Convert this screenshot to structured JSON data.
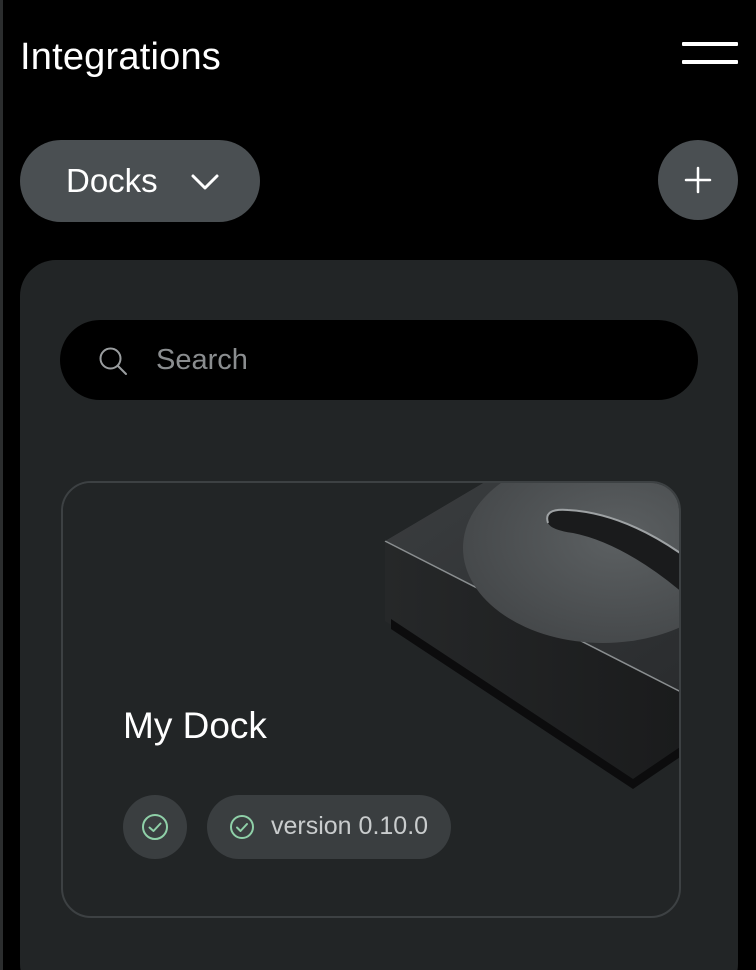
{
  "header": {
    "title": "Integrations",
    "menu_icon": "hamburger-menu-icon"
  },
  "toolbar": {
    "filter_selected": "Docks",
    "filter_icon": "chevron-down-icon",
    "add_icon": "plus-icon"
  },
  "search": {
    "placeholder": "Search",
    "value": "",
    "icon": "search-icon"
  },
  "docks": [
    {
      "name": "My Dock",
      "status_icon": "check-circle-icon",
      "version_label": "version 0.10.0",
      "image": "dock-device-image"
    }
  ],
  "colors": {
    "background": "#000000",
    "panel": "#222526",
    "chip": "#4a4f52",
    "badge": "#3a3e40",
    "status_ok": "#8fd0a8",
    "card_border": "#3d4143"
  }
}
